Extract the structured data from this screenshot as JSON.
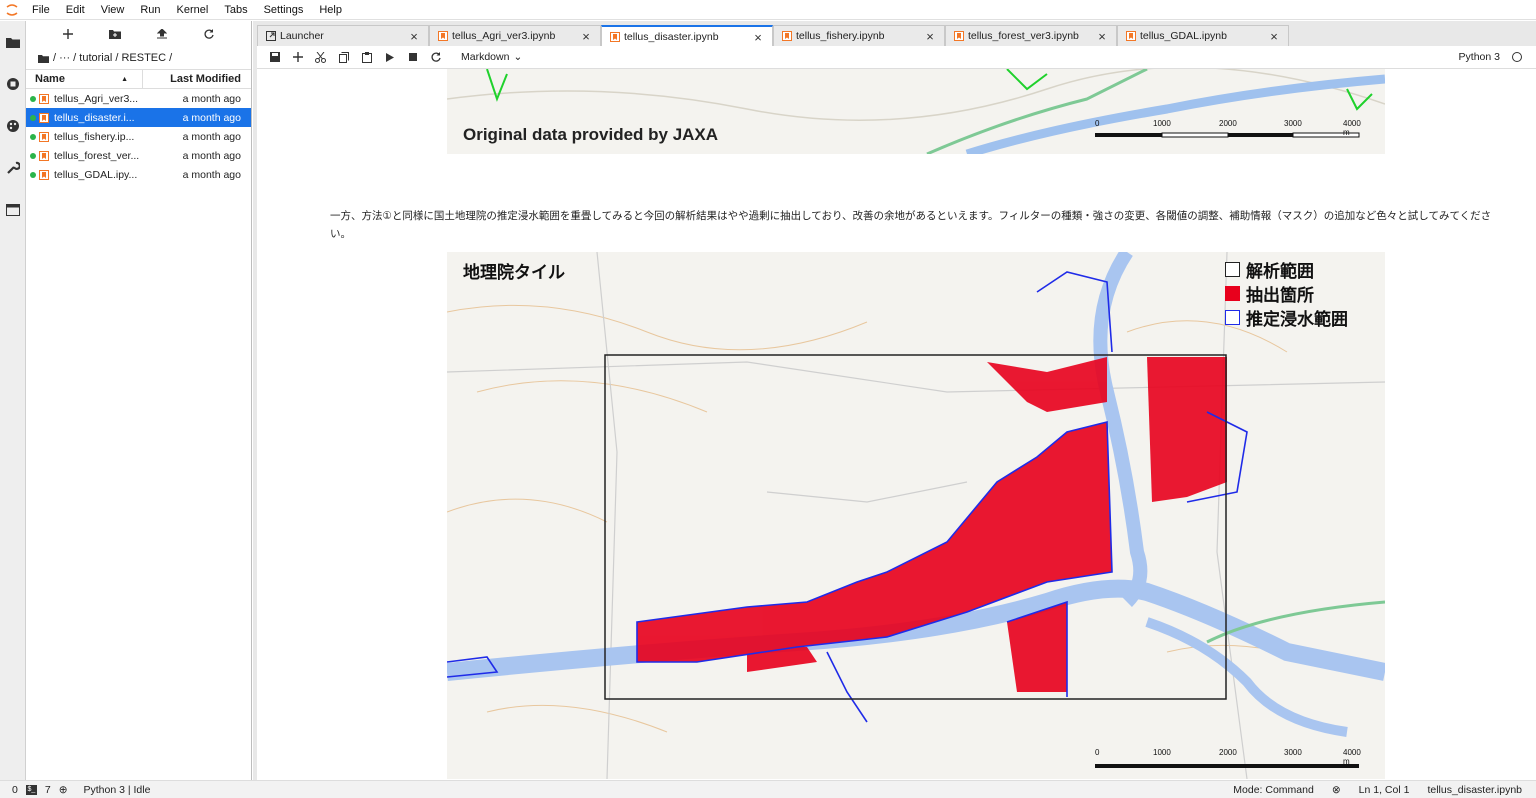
{
  "menu": [
    "File",
    "Edit",
    "View",
    "Run",
    "Kernel",
    "Tabs",
    "Settings",
    "Help"
  ],
  "filebrowser": {
    "breadcrumb": "/ ··· / tutorial / RESTEC /",
    "col_name": "Name",
    "col_modified": "Last Modified",
    "files": [
      {
        "name": "tellus_Agri_ver3...",
        "modified": "a month ago",
        "selected": false
      },
      {
        "name": "tellus_disaster.i...",
        "modified": "a month ago",
        "selected": true
      },
      {
        "name": "tellus_fishery.ip...",
        "modified": "a month ago",
        "selected": false
      },
      {
        "name": "tellus_forest_ver...",
        "modified": "a month ago",
        "selected": false
      },
      {
        "name": "tellus_GDAL.ipy...",
        "modified": "a month ago",
        "selected": false
      }
    ]
  },
  "tabs": [
    {
      "label": "Launcher",
      "icon": "launcher-icon",
      "active": false
    },
    {
      "label": "tellus_Agri_ver3.ipynb",
      "icon": "notebook-icon",
      "active": false
    },
    {
      "label": "tellus_disaster.ipynb",
      "icon": "notebook-icon",
      "active": true
    },
    {
      "label": "tellus_fishery.ipynb",
      "icon": "notebook-icon",
      "active": false
    },
    {
      "label": "tellus_forest_ver3.ipynb",
      "icon": "notebook-icon",
      "active": false
    },
    {
      "label": "tellus_GDAL.ipynb",
      "icon": "notebook-icon",
      "active": false
    }
  ],
  "toolbar": {
    "cell_type": "Markdown",
    "kernel": "Python 3"
  },
  "notebook": {
    "caption1": "Original data provided by JAXA",
    "paragraph": "一方、方法①と同様に国土地理院の推定浸水範囲を重畳してみると今回の解析結果はやや過剰に抽出しており、改善の余地があるといえます。フィルターの種類・強さの変更、各閾値の調整、補助情報（マスク）の追加など色々と試してみてください。",
    "map_title": "地理院タイル",
    "legend": [
      {
        "label": "解析範囲",
        "color": "#ffffff",
        "border": "#222222"
      },
      {
        "label": "抽出箇所",
        "color": "#e8001c",
        "border": "#e8001c"
      },
      {
        "label": "推定浸水範囲",
        "color": "#ffffff",
        "border": "#1f2be8"
      }
    ],
    "scale_ticks": [
      "0",
      "1000",
      "2000",
      "3000",
      "4000 m"
    ]
  },
  "status": {
    "left_num1": "0",
    "left_num2": "7",
    "kernel_status": "Python 3 | Idle",
    "mode": "Mode: Command",
    "position": "Ln 1, Col 1",
    "filename": "tellus_disaster.ipynb"
  }
}
